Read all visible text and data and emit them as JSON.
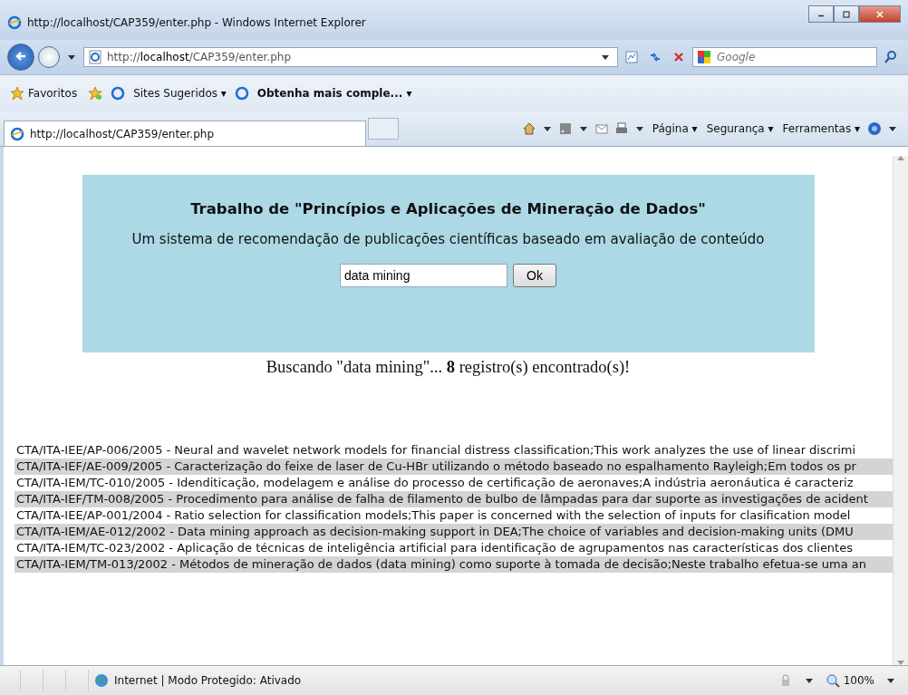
{
  "window": {
    "title": "http://localhost/CAP359/enter.php - Windows Internet Explorer"
  },
  "address_bar": {
    "url_prefix": "http://",
    "url_host": "localhost",
    "url_path": "/CAP359/enter.php"
  },
  "search_box": {
    "placeholder": "Google"
  },
  "favorites_bar": {
    "favorites": "Favoritos",
    "items": [
      {
        "label": "Sites Sugeridos ▾",
        "bold": false
      },
      {
        "label": "Obtenha mais comple... ▾",
        "bold": true
      }
    ]
  },
  "tab": {
    "title": "http://localhost/CAP359/enter.php",
    "selected": true
  },
  "command_bar": [
    "Página ▾",
    "Segurança ▾",
    "Ferramentas ▾"
  ],
  "page": {
    "heading": "Trabalho de \"Princípios e Aplicações de Mineração de Dados\"",
    "subtitle": "Um sistema de recomendação de publicações científicas baseado em avaliação de conteúdo",
    "query": "data mining",
    "button": "Ok",
    "result_summary": "Buscando \"data mining\"... **8** registro(s) encontrado(s)!",
    "results": [
      "CTA/ITA-IEE/AP-006/2005 - Neural and wavelet network models for financial distress classification;This work analyzes the use of linear discrimi",
      "CTA/ITA-IEF/AE-009/2005 - Caracterização do feixe de laser de Cu-HBr utilizando o método baseado no espalhamento Rayleigh;Em todos os pr",
      "CTA/ITA-IEM/TC-010/2005 - Idenditicação, modelagem e análise do processo de certificação de aeronaves;A indústria aeronáutica é caracteriz",
      "CTA/ITA-IEF/TM-008/2005 - Procedimento para análise de falha de filamento de bulbo de lâmpadas para dar suporte as investigações de acident",
      "CTA/ITA-IEE/AP-001/2004 - Ratio selection for classification models;This paper is concerned with the selection of inputs for clasification model",
      "CTA/ITA-IEM/AE-012/2002 - Data mining approach as decision-making support in DEA;The choice of variables and decision-making units (DMU",
      "CTA/ITA-IEM/TC-023/2002 - Aplicação de técnicas de inteligência artificial para identificação de agrupamentos nas características dos clientes",
      "CTA/ITA-IEM/TM-013/2002 - Métodos de mineração de dados (data mining) como suporte à tomada de decisão;Neste trabalho efetua-se uma an"
    ]
  },
  "status_bar": {
    "zone": "Internet | Modo Protegido: Ativado",
    "zoom": "100%"
  }
}
